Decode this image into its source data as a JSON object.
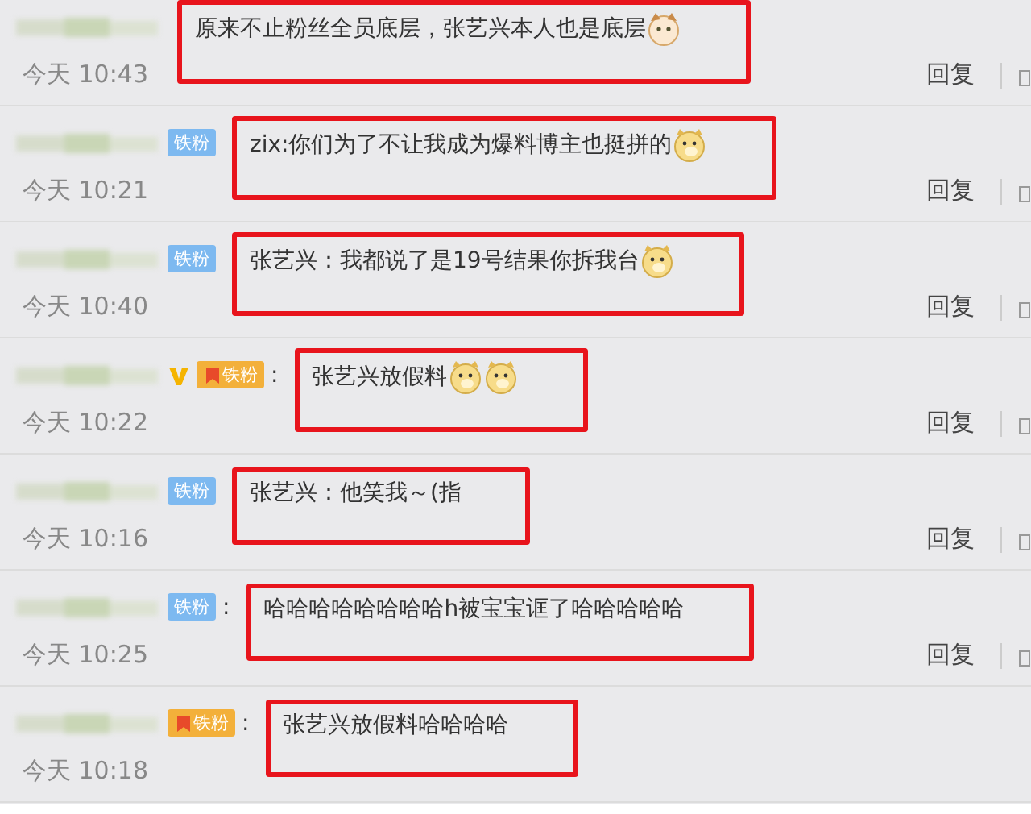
{
  "comments": [
    {
      "verified": false,
      "text": "原来不止粉丝全员底层，张艺兴本人也是底层",
      "emojis": [
        {
          "kind": "cat"
        }
      ],
      "time": "今天 10:43",
      "reply": "回复"
    },
    {
      "verified": false,
      "badge": {
        "label": "铁粉",
        "kind": "plain"
      },
      "text": "zix:你们为了不让我成为爆料博主也挺拼的",
      "emojis": [
        {
          "kind": "dog"
        }
      ],
      "time": "今天 10:21",
      "reply": "回复"
    },
    {
      "verified": false,
      "badge": {
        "label": "铁粉",
        "kind": "plain"
      },
      "text": "张艺兴：我都说了是19号结果你拆我台",
      "emojis": [
        {
          "kind": "dog"
        }
      ],
      "time": "今天 10:40",
      "reply": "回复"
    },
    {
      "verified": true,
      "badge": {
        "label": "铁粉",
        "kind": "gold"
      },
      "colon": ":",
      "text": "张艺兴放假料",
      "emojis": [
        {
          "kind": "dog"
        },
        {
          "kind": "dog"
        }
      ],
      "time": "今天 10:22",
      "reply": "回复"
    },
    {
      "verified": false,
      "badge": {
        "label": "铁粉",
        "kind": "plain"
      },
      "text": "张艺兴：他笑我～(指",
      "time": "今天 10:16",
      "reply": "回复"
    },
    {
      "verified": false,
      "badge": {
        "label": "铁粉",
        "kind": "plain"
      },
      "colon": ":",
      "text": "哈哈哈哈哈哈哈哈h被宝宝诓了哈哈哈哈哈",
      "time": "今天 10:25",
      "reply": "回复"
    },
    {
      "verified": false,
      "badge": {
        "label": "铁粉",
        "kind": "gold"
      },
      "colon": ":",
      "text": "张艺兴放假料哈哈哈哈",
      "time": "今天 10:18"
    }
  ]
}
